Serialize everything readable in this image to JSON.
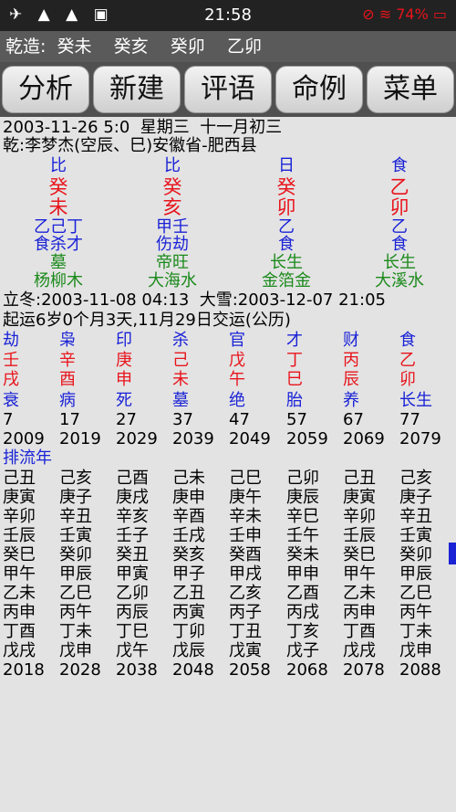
{
  "status": {
    "left_icons": "✈ ▲ ▲ ▣",
    "time": "21:58",
    "right": "⊘ ≋ 74% ▭"
  },
  "title": "乾造:  癸未    癸亥    癸卯    乙卯",
  "toolbar": [
    "分析",
    "新建",
    "评语",
    "命例",
    "菜单"
  ],
  "info": {
    "line1": "2003-11-26 5:0  星期三  十一月初三",
    "line2": "乾:李梦杰(空辰、巳)安徽省-肥西县"
  },
  "pillars": [
    {
      "god": "比",
      "stem": "癸",
      "branch": "未",
      "hidden": "乙己丁",
      "hidden_gods": "食杀才",
      "stage": "墓",
      "nayin": "杨柳木"
    },
    {
      "god": "比",
      "stem": "癸",
      "branch": "亥",
      "hidden": "甲壬",
      "hidden_gods": "伤劫",
      "stage": "帝旺",
      "nayin": "大海水"
    },
    {
      "god": "日",
      "stem": "癸",
      "branch": "卯",
      "hidden": "乙",
      "hidden_gods": "食",
      "stage": "长生",
      "nayin": "金箔金"
    },
    {
      "god": "食",
      "stem": "乙",
      "branch": "卯",
      "hidden": "乙",
      "hidden_gods": "食",
      "stage": "长生",
      "nayin": "大溪水"
    }
  ],
  "terms": "立冬:2003-11-08 04:13  大雪:2003-12-07 21:05",
  "qiyun": "起运6岁0个月3天,11月29日交运(公历)",
  "dayun": [
    {
      "god": "劫",
      "stem": "壬",
      "branch": "戌",
      "stage": "衰",
      "age": "7",
      "year": "2009"
    },
    {
      "god": "枭",
      "stem": "辛",
      "branch": "酉",
      "stage": "病",
      "age": "17",
      "year": "2019"
    },
    {
      "god": "印",
      "stem": "庚",
      "branch": "申",
      "stage": "死",
      "age": "27",
      "year": "2029"
    },
    {
      "god": "杀",
      "stem": "己",
      "branch": "未",
      "stage": "墓",
      "age": "37",
      "year": "2039"
    },
    {
      "god": "官",
      "stem": "戊",
      "branch": "午",
      "stage": "绝",
      "age": "47",
      "year": "2049"
    },
    {
      "god": "才",
      "stem": "丁",
      "branch": "巳",
      "stage": "胎",
      "age": "57",
      "year": "2059"
    },
    {
      "god": "财",
      "stem": "丙",
      "branch": "辰",
      "stage": "养",
      "age": "67",
      "year": "2069"
    },
    {
      "god": "食",
      "stem": "乙",
      "branch": "卯",
      "stage": "长生",
      "age": "77",
      "year": "2079"
    }
  ],
  "liunian_label": "排流年",
  "liunian": [
    {
      "items": [
        "己丑",
        "庚寅",
        "辛卯",
        "壬辰",
        "癸巳",
        "甲午",
        "乙未",
        "丙申",
        "丁酉",
        "戊戌"
      ],
      "end": "2018"
    },
    {
      "items": [
        "己亥",
        "庚子",
        "辛丑",
        "壬寅",
        "癸卯",
        "甲辰",
        "乙巳",
        "丙午",
        "丁未",
        "戊申"
      ],
      "end": "2028"
    },
    {
      "items": [
        "己酉",
        "庚戌",
        "辛亥",
        "壬子",
        "癸丑",
        "甲寅",
        "乙卯",
        "丙辰",
        "丁巳",
        "戊午"
      ],
      "end": "2038"
    },
    {
      "items": [
        "己未",
        "庚申",
        "辛酉",
        "壬戌",
        "癸亥",
        "甲子",
        "乙丑",
        "丙寅",
        "丁卯",
        "戊辰"
      ],
      "end": "2048"
    },
    {
      "items": [
        "己巳",
        "庚午",
        "辛未",
        "壬申",
        "癸酉",
        "甲戌",
        "乙亥",
        "丙子",
        "丁丑",
        "戊寅"
      ],
      "end": "2058"
    },
    {
      "items": [
        "己卯",
        "庚辰",
        "辛巳",
        "壬午",
        "癸未",
        "甲申",
        "乙酉",
        "丙戌",
        "丁亥",
        "戊子"
      ],
      "end": "2068"
    },
    {
      "items": [
        "己丑",
        "庚寅",
        "辛卯",
        "壬辰",
        "癸巳",
        "甲午",
        "乙未",
        "丙申",
        "丁酉",
        "戊戌"
      ],
      "end": "2078"
    },
    {
      "items": [
        "己亥",
        "庚子",
        "辛丑",
        "壬寅",
        "癸卯",
        "甲辰",
        "乙巳",
        "丙午",
        "丁未",
        "戊申"
      ],
      "end": "2088"
    }
  ]
}
